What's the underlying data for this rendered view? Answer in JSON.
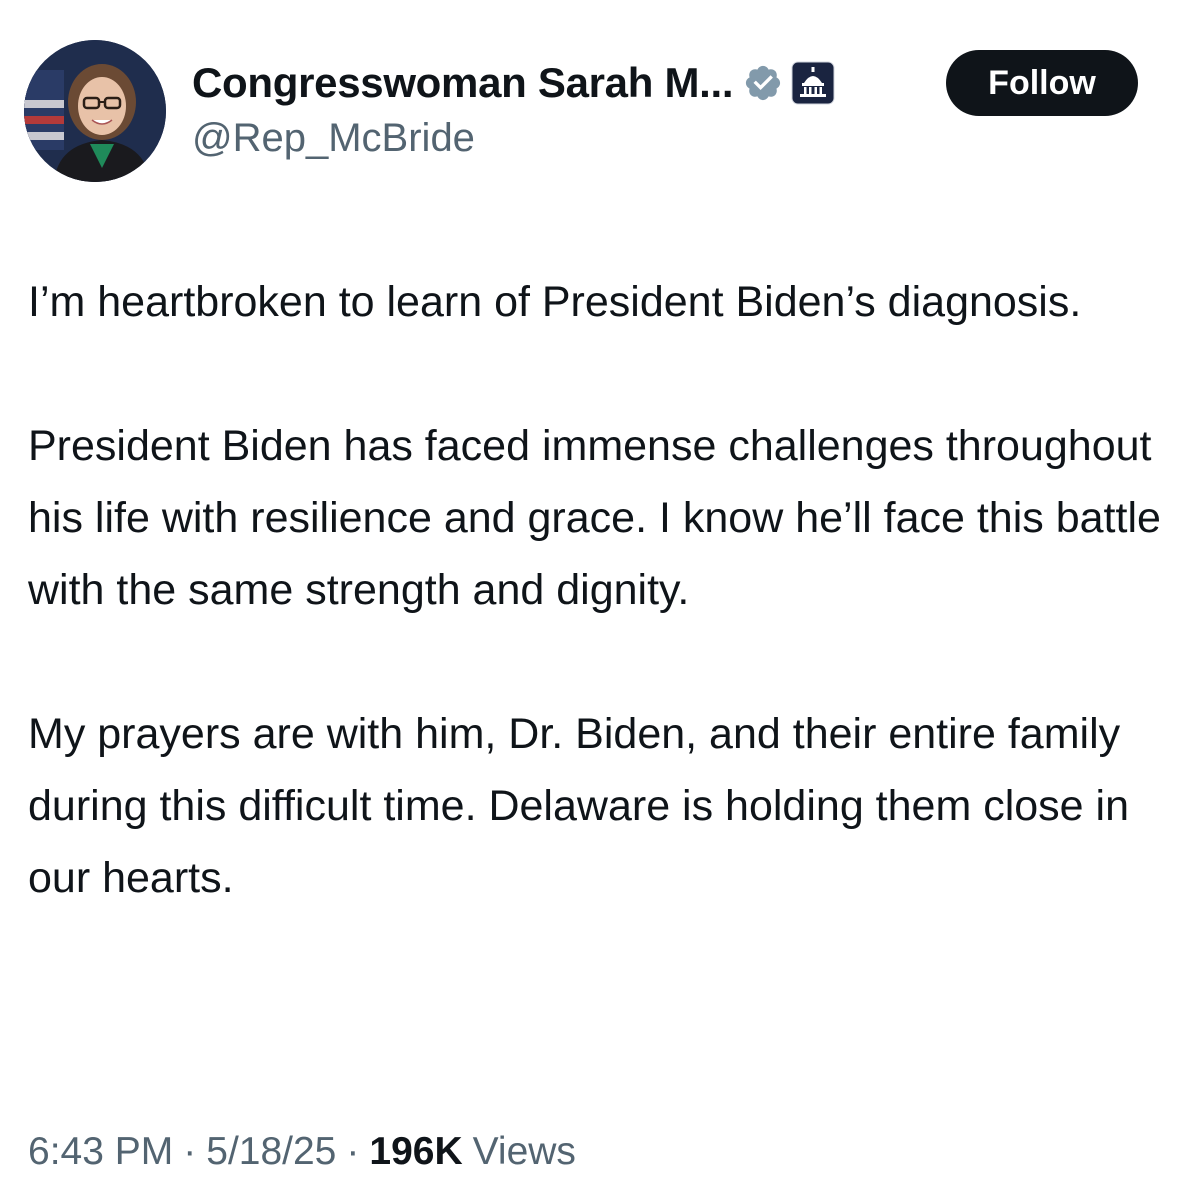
{
  "author": {
    "display_name": "Congresswoman Sarah M...",
    "handle": "@Rep_McBride",
    "verified_icon": "verified-badge-icon",
    "affiliation_icon": "capitol-building-icon"
  },
  "actions": {
    "follow_label": "Follow"
  },
  "tweet": {
    "paragraphs": [
      "I’m heartbroken to learn of President Biden’s diagnosis.",
      "President Biden has faced immense challenges throughout his life with resilience and grace. I know he’ll face this battle with the same strength and dignity.",
      "My prayers are with him, Dr. Biden, and their entire family during this difficult time. Delaware is holding them close in our hearts."
    ]
  },
  "meta": {
    "time": "6:43 PM",
    "separator": "·",
    "date": "5/18/25",
    "views_count": "196K",
    "views_label": "Views"
  },
  "colors": {
    "text_primary": "#0f1419",
    "text_secondary": "#536471",
    "verified_badge": "#829aab",
    "follow_button_bg": "#0f1419"
  }
}
